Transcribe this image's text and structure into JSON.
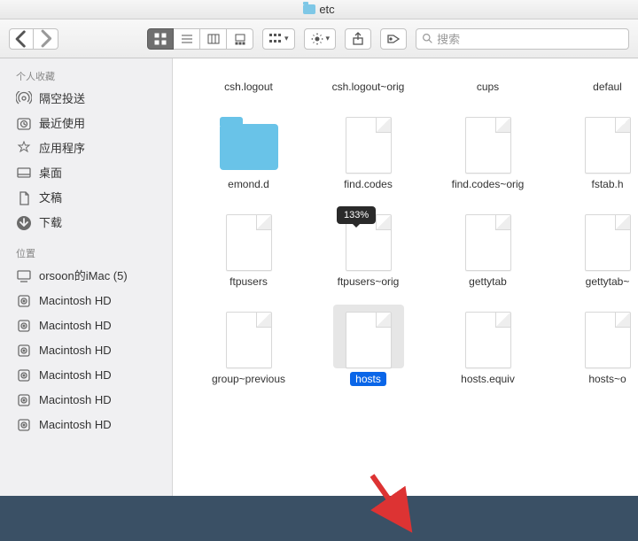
{
  "window": {
    "title": "etc"
  },
  "toolbar": {
    "search_placeholder": "搜索",
    "zoom_badge": "133%"
  },
  "sidebar": {
    "favorites_header": "个人收藏",
    "favorites": [
      {
        "label": "隔空投送",
        "icon": "airdrop"
      },
      {
        "label": "最近使用",
        "icon": "clock"
      },
      {
        "label": "应用程序",
        "icon": "apps"
      },
      {
        "label": "桌面",
        "icon": "desktop"
      },
      {
        "label": "文稿",
        "icon": "document"
      },
      {
        "label": "下载",
        "icon": "download"
      }
    ],
    "locations_header": "位置",
    "locations": [
      {
        "label": "orsoon的iMac (5)",
        "icon": "computer"
      },
      {
        "label": "Macintosh HD",
        "icon": "disk"
      },
      {
        "label": "Macintosh HD",
        "icon": "disk"
      },
      {
        "label": "Macintosh HD",
        "icon": "disk"
      },
      {
        "label": "Macintosh HD",
        "icon": "disk"
      },
      {
        "label": "Macintosh HD",
        "icon": "disk"
      },
      {
        "label": "Macintosh HD",
        "icon": "disk"
      }
    ]
  },
  "files": {
    "row0": [
      {
        "name": "csh.logout"
      },
      {
        "name": "csh.logout~orig"
      },
      {
        "name": "cups"
      },
      {
        "name": "defaul"
      }
    ],
    "row1": [
      {
        "name": "emond.d",
        "type": "folder"
      },
      {
        "name": "find.codes"
      },
      {
        "name": "find.codes~orig"
      },
      {
        "name": "fstab.h"
      }
    ],
    "row2": [
      {
        "name": "ftpusers"
      },
      {
        "name": "ftpusers~orig"
      },
      {
        "name": "gettytab"
      },
      {
        "name": "gettytab~"
      }
    ],
    "row3": [
      {
        "name": "group~previous"
      },
      {
        "name": "hosts",
        "selected": true
      },
      {
        "name": "hosts.equiv"
      },
      {
        "name": "hosts~o"
      }
    ]
  }
}
